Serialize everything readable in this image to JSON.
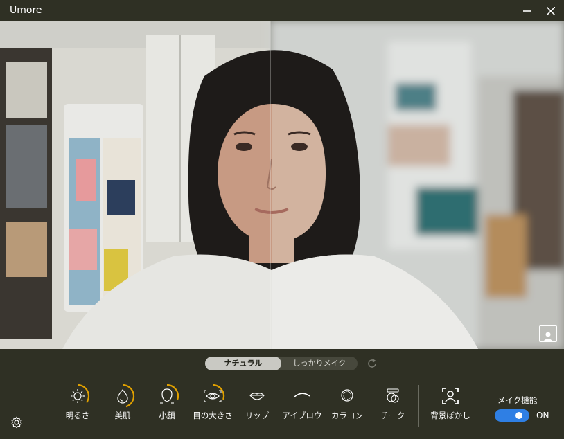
{
  "window": {
    "title": "Umore"
  },
  "mode_toggle": {
    "options": [
      "ナチュラル",
      "しっかりメイク"
    ],
    "selected": "ナチュラル"
  },
  "tools": [
    {
      "label": "明るさ",
      "icon": "brightness-icon",
      "level": 0.35
    },
    {
      "label": "美肌",
      "icon": "skin-drop-icon",
      "level": 0.45
    },
    {
      "label": "小顔",
      "icon": "face-slim-icon",
      "level": 0.3
    },
    {
      "label": "目の大きさ",
      "icon": "eye-size-icon",
      "level": 0.3
    },
    {
      "label": "リップ",
      "icon": "lip-icon",
      "level": 0
    },
    {
      "label": "アイブロウ",
      "icon": "eyebrow-icon",
      "level": 0
    },
    {
      "label": "カラコン",
      "icon": "color-contact-icon",
      "level": 0
    },
    {
      "label": "チーク",
      "icon": "cheek-icon",
      "level": 0
    }
  ],
  "background_blur": {
    "label": "背景ぼかし",
    "icon": "person-frame-icon"
  },
  "makeup_feature": {
    "label": "メイク機能",
    "state": "ON",
    "enabled": true
  },
  "colors": {
    "accent": "#e0a000",
    "toggle": "#2f7fe4",
    "bg": "#2f3024"
  }
}
